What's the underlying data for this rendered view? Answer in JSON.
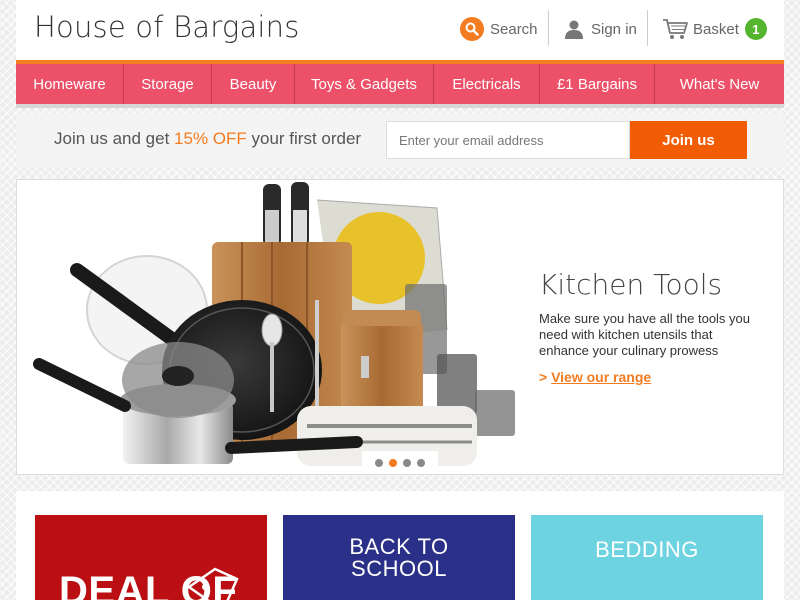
{
  "header": {
    "logo": "House of Bargains",
    "search_label": "Search",
    "signin_label": "Sign in",
    "basket_label": "Basket",
    "basket_count": "1"
  },
  "nav": {
    "items": [
      "Homeware",
      "Storage",
      "Beauty",
      "Toys & Gadgets",
      "Electricals",
      "£1 Bargains",
      "What's New"
    ]
  },
  "signup": {
    "text_before": "Join us and get ",
    "highlight": "15% OFF",
    "text_after": " your first order",
    "email_placeholder": "Enter your email address",
    "button_label": "Join us"
  },
  "hero": {
    "title": "Kitchen Tools",
    "description": "Make sure you have all the tools you need with kitchen utensils that enhance your culinary prowess",
    "link_arrow": ">",
    "link_label": "View our range",
    "slide_count": 4,
    "active_slide": 2
  },
  "promos": {
    "deal_label": "DEAL OF",
    "back_to_school_label": "BACK TO SCHOOL",
    "bedding_label": "BEDDING"
  },
  "colors": {
    "accent_orange": "#f47b20",
    "nav_pink": "#ec5169",
    "basket_green": "#55b52e",
    "promo_red": "#bb0f13",
    "promo_navy": "#2a3088",
    "promo_cyan": "#6dd3e0"
  }
}
